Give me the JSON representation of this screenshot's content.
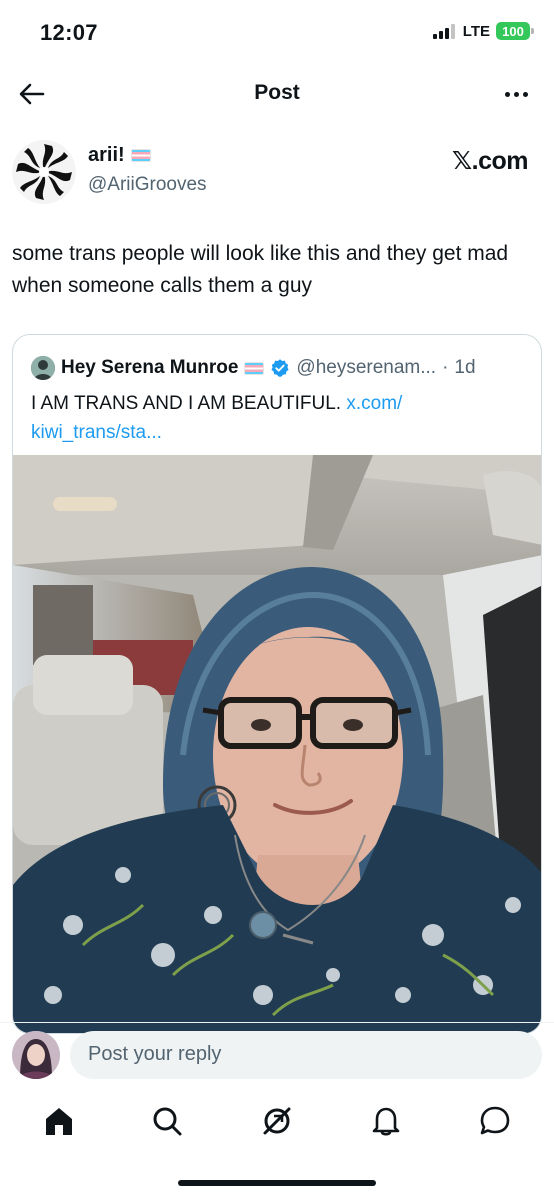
{
  "status_bar": {
    "time": "12:07",
    "network": "LTE",
    "battery": "100",
    "battery_color": "#34c759"
  },
  "header": {
    "title": "Post",
    "back_icon": "arrow-left-icon",
    "more_icon": "more-horizontal-icon"
  },
  "post": {
    "author": {
      "name": "arii!",
      "handle": "@AriiGrooves",
      "flag": "transgender-flag-emoji"
    },
    "source_label": "𝕏.com",
    "text": "some trans people will look like this and they get mad when someone calls them a guy",
    "quote": {
      "name": "Hey Serena Munroe",
      "flag": "transgender-flag-emoji",
      "verified": true,
      "handle": "@heyserenam...",
      "separator": "·",
      "time": "1d",
      "text": "I AM TRANS AND I AM BEAUTIFUL.",
      "link": "x.com/​kiwi_trans/sta..."
    }
  },
  "reply": {
    "placeholder": "Post your reply"
  },
  "nav": {
    "items": [
      "home-icon",
      "search-icon",
      "grok-icon",
      "notifications-icon",
      "messages-icon"
    ]
  },
  "colors": {
    "accent": "#1d9bf0",
    "text_primary": "#0f1419",
    "text_secondary": "#536471",
    "border": "#cfd9de"
  }
}
